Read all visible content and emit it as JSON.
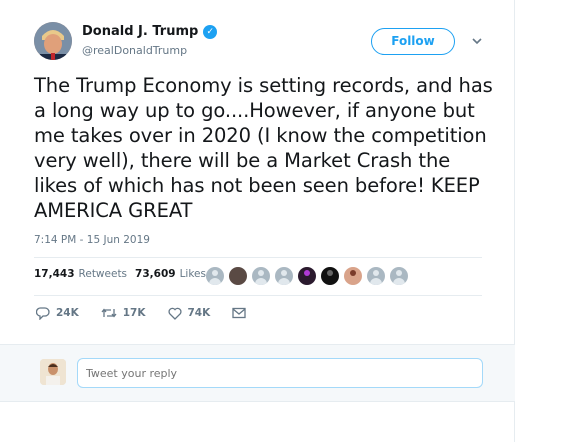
{
  "author": {
    "name": "Donald J. Trump",
    "handle": "@realDonaldTrump",
    "verified": true
  },
  "follow_label": "Follow",
  "tweet": {
    "text": "The Trump Economy is setting records, and has a long way up to go....However, if anyone but me takes over in 2020 (I know the competition very well), there will be a Market Crash the likes of which has not been seen before! KEEP AMERICA GREAT",
    "timestamp": "7:14 PM - 15 Jun 2019"
  },
  "stats": {
    "retweets_count": "17,443",
    "retweets_label": "Retweets",
    "likes_count": "73,609",
    "likes_label": "Likes"
  },
  "likers": [
    "default",
    "photo-dark",
    "default",
    "default",
    "photo-purple",
    "photo-black",
    "photo-face",
    "default",
    "default"
  ],
  "actions": {
    "reply_count": "24K",
    "retweet_count": "17K",
    "like_count": "74K"
  },
  "reply_box": {
    "placeholder": "Tweet your reply"
  },
  "colors": {
    "accent": "#1da1f2",
    "text": "#14171a",
    "muted": "#657786",
    "border": "#e6ecf0"
  }
}
